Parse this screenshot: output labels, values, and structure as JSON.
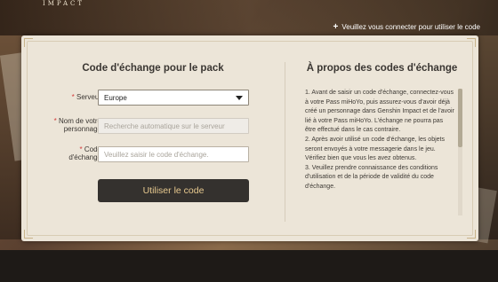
{
  "brand": {
    "logo_text": "IMPACT"
  },
  "header": {
    "login_hint": "Veuillez vous connecter pour utiliser le code",
    "plus_glyph": "+"
  },
  "form": {
    "title": "Code d'échange pour le pack",
    "server": {
      "required_mark": "* ",
      "label": "Serveur",
      "value": "Europe"
    },
    "character": {
      "required_mark": "* ",
      "label_line1": "Nom de votre",
      "label_line2": "personnage",
      "placeholder": "Recherche automatique sur le serveur"
    },
    "code": {
      "required_mark": "* ",
      "label_line1": "Code",
      "label_line2": "d'échange",
      "placeholder": "Veuillez saisir le code d'échange."
    },
    "submit_label": "Utiliser le code"
  },
  "about": {
    "title": "À propos des codes d'échange",
    "items": [
      "1. Avant de saisir un code d'échange, connectez-vous à votre Pass miHoYo, puis assurez-vous d'avoir déjà créé un personnage dans Genshin Impact et de l'avoir lié à votre Pass miHoYo. L'échange ne pourra pas être effectué dans le cas contraire.",
      "2. Après avoir utilisé un code d'échange, les objets seront envoyés à votre messagerie dans le jeu. Vérifiez bien que vous les avez obtenus.",
      "3. Veuillez prendre connaissance des conditions d'utilisation et de la période de validité du code d'échange."
    ]
  },
  "colors": {
    "panel": "#ece5d8",
    "button": "#34312e",
    "button_text": "#e7c98f",
    "required": "#d23a3a"
  },
  "icons": {
    "dropdown": "chevron-down-icon",
    "login": "plus-icon",
    "scroll": "scrollbar"
  }
}
